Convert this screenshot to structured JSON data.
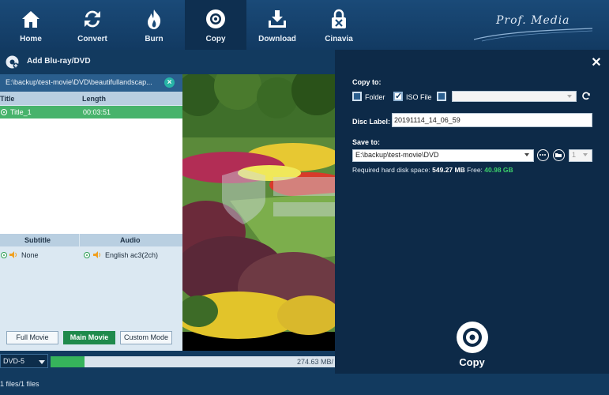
{
  "nav": {
    "items": [
      {
        "label": "Home",
        "icon": "home-icon"
      },
      {
        "label": "Convert",
        "icon": "convert-icon"
      },
      {
        "label": "Burn",
        "icon": "burn-icon"
      },
      {
        "label": "Copy",
        "icon": "copy-disc-icon",
        "active": true
      },
      {
        "label": "Download",
        "icon": "download-icon"
      },
      {
        "label": "Cinavia",
        "icon": "cinavia-icon"
      }
    ],
    "brand": "Prof. Media"
  },
  "subbar": {
    "add_label": "Add Blu-ray/DVD"
  },
  "source": {
    "path": "E:\\backup\\test-movie\\DVD\\beautifullandscap..."
  },
  "titles_table": {
    "columns": [
      "Title",
      "Length"
    ],
    "rows": [
      {
        "title": "Title_1",
        "length": "00:03:51",
        "selected": true
      }
    ]
  },
  "tracks": {
    "subtitle_header": "Subtitle",
    "audio_header": "Audio",
    "subtitle_value": "None",
    "audio_value": "English ac3(2ch)"
  },
  "modes": {
    "full": "Full Movie",
    "main": "Main Movie",
    "custom": "Custom Mode",
    "active": "main"
  },
  "bottom": {
    "disc_type": "DVD-5",
    "progress_fraction": 0.12,
    "size": "274.63 MB/"
  },
  "status": {
    "files": "1 files/1 files"
  },
  "copy_dialog": {
    "copy_to_label": "Copy to:",
    "folder_label": "Folder",
    "iso_label": "ISO File",
    "folder_checked": false,
    "iso_checked": true,
    "disc_checked": false,
    "disc_label_label": "Disc Label:",
    "disc_label_value": "20191114_14_06_59",
    "save_to_label": "Save to:",
    "save_path": "E:\\backup\\test-movie\\DVD",
    "copies": "1",
    "disk_space_prefix": "Required hard disk space: ",
    "disk_space_value": "549.27 MB",
    "free_prefix": " Free: ",
    "free_value": "40.98 GB",
    "copy_button": "Copy"
  },
  "colors": {
    "nav_bg": "#1a4a78",
    "active_green": "#1f8a4c",
    "selection_green": "#47b36b",
    "free_green": "#3ccf6b",
    "dialog_bg": "#0d2a48"
  }
}
